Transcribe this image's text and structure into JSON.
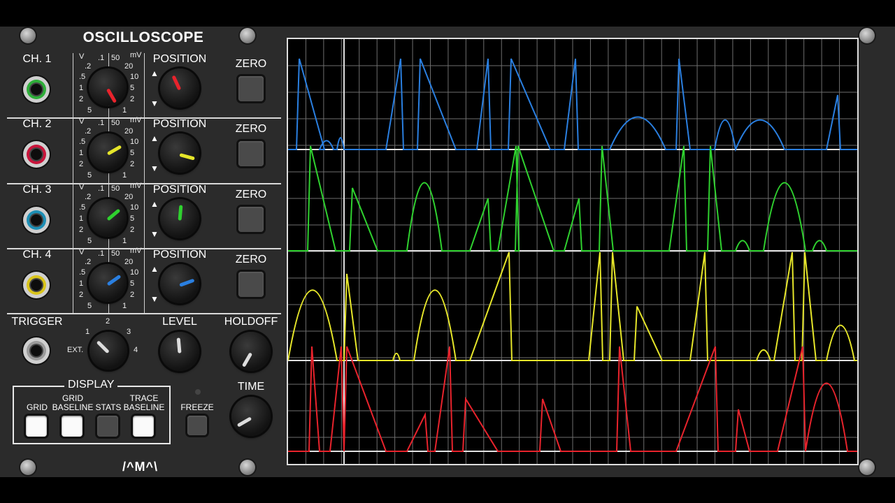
{
  "module": {
    "title": "OSCILLOSCOPE",
    "logo": "/^M^\\"
  },
  "channels": [
    {
      "label": "CH. 1",
      "jack_color": "#2fae3a",
      "knob_color": "#e8232c",
      "scale_angle": 60,
      "position_angle": -115
    },
    {
      "label": "CH. 2",
      "jack_color": "#c8153b",
      "knob_color": "#e6e62a",
      "scale_angle": -30,
      "position_angle": 15
    },
    {
      "label": "CH. 3",
      "jack_color": "#1e8fb5",
      "knob_color": "#2fd12f",
      "scale_angle": -40,
      "position_angle": -85
    },
    {
      "label": "CH. 4",
      "jack_color": "#d9c41c",
      "knob_color": "#2a7fe0",
      "scale_angle": -35,
      "position_angle": -20
    }
  ],
  "scale_labels": {
    "volts_unit": "V",
    "millivolts_unit": "mV",
    "left_ticks": [
      ".1",
      ".2",
      ".5",
      "1",
      "2",
      "5"
    ],
    "right_ticks": [
      "50",
      "20",
      "10",
      "5",
      "2",
      "1"
    ]
  },
  "controls": {
    "position_label": "POSITION",
    "zero_label": "ZERO",
    "up_arrow": "▲",
    "down_arrow": "▼",
    "trigger_label": "TRIGGER",
    "trigger_ticks": [
      "1",
      "2",
      "3",
      "4",
      "EXT."
    ],
    "level_label": "LEVEL",
    "holdoff_label": "HOLDOFF",
    "time_label": "TIME",
    "freeze_label": "FREEZE"
  },
  "display": {
    "title": "DISPLAY",
    "buttons": [
      {
        "label": "GRID",
        "on": true
      },
      {
        "label": "GRID\nBASELINE",
        "on": true
      },
      {
        "label": "STATS",
        "on": false
      },
      {
        "label": "TRACE\nBASELINE",
        "on": true
      }
    ]
  },
  "scope_traces": [
    {
      "channel": "CH. 1",
      "color": "#2a7fe0"
    },
    {
      "channel": "CH. 2",
      "color": "#2fd12f"
    },
    {
      "channel": "CH. 3",
      "color": "#e6e62a"
    },
    {
      "channel": "CH. 4",
      "color": "#e8232c"
    }
  ]
}
